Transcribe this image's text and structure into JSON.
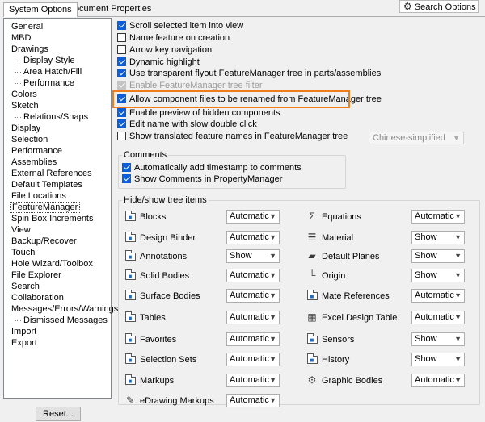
{
  "tabs": [
    {
      "label": "System Options",
      "active": true
    },
    {
      "label": "Document Properties",
      "active": false
    }
  ],
  "search": {
    "label": "Search Options",
    "icon": "gear-icon"
  },
  "tree": {
    "items": [
      {
        "label": "General",
        "level": 0
      },
      {
        "label": "MBD",
        "level": 0
      },
      {
        "label": "Drawings",
        "level": 0
      },
      {
        "label": "Display Style",
        "level": 1
      },
      {
        "label": "Area Hatch/Fill",
        "level": 1
      },
      {
        "label": "Performance",
        "level": 1
      },
      {
        "label": "Colors",
        "level": 0
      },
      {
        "label": "Sketch",
        "level": 0
      },
      {
        "label": "Relations/Snaps",
        "level": 1
      },
      {
        "label": "Display",
        "level": 0
      },
      {
        "label": "Selection",
        "level": 0
      },
      {
        "label": "Performance",
        "level": 0
      },
      {
        "label": "Assemblies",
        "level": 0
      },
      {
        "label": "External References",
        "level": 0
      },
      {
        "label": "Default Templates",
        "level": 0
      },
      {
        "label": "File Locations",
        "level": 0
      },
      {
        "label": "FeatureManager",
        "level": 0,
        "selected": true
      },
      {
        "label": "Spin Box Increments",
        "level": 0
      },
      {
        "label": "View",
        "level": 0
      },
      {
        "label": "Backup/Recover",
        "level": 0
      },
      {
        "label": "Touch",
        "level": 0
      },
      {
        "label": "Hole Wizard/Toolbox",
        "level": 0
      },
      {
        "label": "File Explorer",
        "level": 0
      },
      {
        "label": "Search",
        "level": 0
      },
      {
        "label": "Collaboration",
        "level": 0
      },
      {
        "label": "Messages/Errors/Warnings",
        "level": 0
      },
      {
        "label": "Dismissed Messages",
        "level": 1
      },
      {
        "label": "Import",
        "level": 0
      },
      {
        "label": "Export",
        "level": 0
      }
    ],
    "reset_label": "Reset..."
  },
  "options": [
    {
      "label": "Scroll selected item into view",
      "checked": true,
      "disabled": false
    },
    {
      "label": "Name feature on creation",
      "checked": false,
      "disabled": false
    },
    {
      "label": "Arrow key navigation",
      "checked": false,
      "disabled": false
    },
    {
      "label": "Dynamic highlight",
      "checked": true,
      "disabled": false
    },
    {
      "label": "Use transparent flyout FeatureManager tree in parts/assemblies",
      "checked": true,
      "disabled": false
    },
    {
      "label": "Enable FeatureManager tree filter",
      "checked": true,
      "disabled": true
    },
    {
      "label": "Allow component files to be renamed from FeatureManager tree",
      "checked": true,
      "disabled": false,
      "highlighted": true
    },
    {
      "label": "Enable preview of hidden components",
      "checked": true,
      "disabled": false
    },
    {
      "label": "Edit name with slow double click",
      "checked": true,
      "disabled": false
    },
    {
      "label": "Show translated feature names in FeatureManager tree",
      "checked": false,
      "disabled": false
    }
  ],
  "language_select": {
    "value": "Chinese-simplified",
    "disabled": true
  },
  "comments": {
    "title": "Comments",
    "items": [
      {
        "label": "Automatically add timestamp to comments",
        "checked": true
      },
      {
        "label": "Show Comments in PropertyManager",
        "checked": true
      }
    ]
  },
  "hide_show": {
    "title": "Hide/show tree items",
    "left": [
      {
        "label": "Blocks",
        "value": "Automatic",
        "icon": "blocks-icon"
      },
      {
        "label": "Design Binder",
        "value": "Automatic",
        "icon": "design-binder-icon"
      },
      {
        "label": "Annotations",
        "value": "Show",
        "icon": "annotations-icon"
      },
      {
        "label": "Solid Bodies",
        "value": "Automatic",
        "icon": "solid-bodies-icon"
      },
      {
        "label": "Surface Bodies",
        "value": "Automatic",
        "icon": "surface-bodies-icon"
      },
      {
        "label": "Tables",
        "value": "Automatic",
        "icon": "tables-icon"
      },
      {
        "label": "Favorites",
        "value": "Automatic",
        "icon": "favorites-icon"
      },
      {
        "label": "Selection Sets",
        "value": "Automatic",
        "icon": "selection-sets-icon"
      },
      {
        "label": "Markups",
        "value": "Automatic",
        "icon": "markups-icon"
      },
      {
        "label": "eDrawing Markups",
        "value": "Automatic",
        "icon": "edrawing-markups-icon"
      }
    ],
    "right": [
      {
        "label": "Equations",
        "value": "Automatic",
        "icon": "equations-icon"
      },
      {
        "label": "Material",
        "value": "Show",
        "icon": "material-icon"
      },
      {
        "label": "Default Planes",
        "value": "Show",
        "icon": "default-planes-icon"
      },
      {
        "label": "Origin",
        "value": "Show",
        "icon": "origin-icon"
      },
      {
        "label": "Mate References",
        "value": "Automatic",
        "icon": "mate-references-icon"
      },
      {
        "label": "Excel Design Table",
        "value": "Automatic",
        "icon": "excel-design-table-icon"
      },
      {
        "label": "Sensors",
        "value": "Show",
        "icon": "sensors-icon"
      },
      {
        "label": "History",
        "value": "Show",
        "icon": "history-icon"
      },
      {
        "label": "Graphic Bodies",
        "value": "Automatic",
        "icon": "graphic-bodies-icon"
      }
    ]
  },
  "colors": {
    "highlight_border": "#f07c1b",
    "checkbox_checked": "#0b5ed7"
  }
}
